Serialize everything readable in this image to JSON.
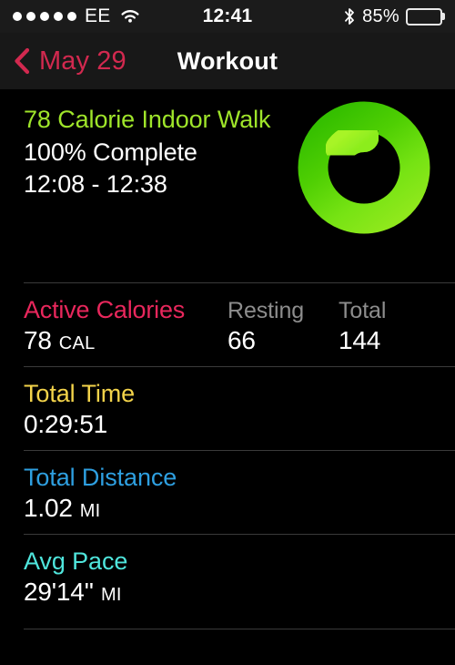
{
  "status_bar": {
    "signal_dots": 5,
    "carrier": "EE",
    "wifi_icon": "wifi-icon",
    "time": "12:41",
    "bluetooth_icon": "bluetooth-icon",
    "battery_percent": "85%",
    "battery_level": 85
  },
  "nav_bar": {
    "back_icon": "chevron-left-icon",
    "back_label": "May 29",
    "title": "Workout",
    "accent_color": "#d2294f"
  },
  "summary": {
    "workout_title": "78 Calorie Indoor Walk",
    "completion": "100% Complete",
    "time_range": "12:08 - 12:38",
    "title_color": "#9fe52a",
    "ring": {
      "name": "move-progress-ring",
      "progress_percent": 100,
      "color_start": "#3ec200",
      "color_end": "#a6f223"
    }
  },
  "metrics": {
    "calories": {
      "label_active": "Active Calories",
      "label_resting": "Resting",
      "label_total": "Total",
      "value_active": "78",
      "unit_active": "CAL",
      "value_resting": "66",
      "value_total": "144",
      "label_color": "#e8275c"
    },
    "rows": [
      {
        "label": "Total Time",
        "value": "0:29:51",
        "unit": "",
        "color": "#f3d34a"
      },
      {
        "label": "Total Distance",
        "value": "1.02",
        "unit": "MI",
        "color": "#2e9fe0"
      },
      {
        "label": "Avg Pace",
        "value": "29'14''",
        "unit": "MI",
        "color": "#4fe5dc"
      }
    ]
  }
}
